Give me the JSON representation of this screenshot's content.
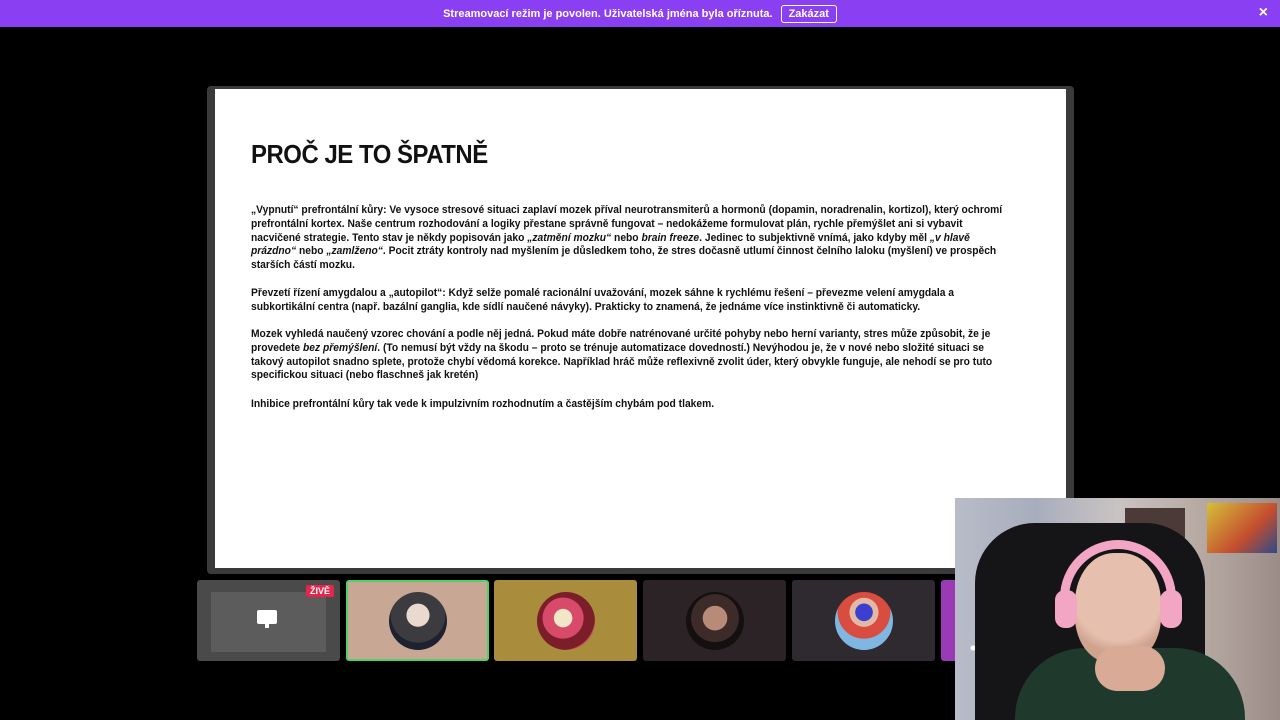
{
  "banner": {
    "message": "Streamovací režim je povolen. Uživatelská jména byla oříznuta.",
    "disable_label": "Zakázat",
    "close_icon": "×",
    "color": "#8a3ff2"
  },
  "slide": {
    "title": "PROČ JE TO ŠPATNĚ",
    "p1": "„Vypnutí“ prefrontální kůry: Ve vysoce stresové situaci zaplaví mozek příval neurotransmiterů a hormonů (dopamin, noradrenalin, kortizol), který ochromí prefrontální kortex. Naše centrum rozhodování a logiky přestane správně fungovat – nedokážeme formulovat plán, rychle přemýšlet ani si vybavit nacvičené strategie. Tento stav je někdy popisován jako",
    "p1_em1": "„zatmění mozku“",
    "p1_mid1": "nebo",
    "p1_em2": "brain freeze",
    "p1_mid2": ". Jedinec to subjektivně vnímá, jako kdyby měl",
    "p1_em3": "„v hlavě prázdno“",
    "p1_mid3": "nebo",
    "p1_em4": "„zamlženo“",
    "p1_end": ". Pocit ztráty kontroly nad myšlením je důsledkem toho, že stres dočasně utlumí činnost čelního laloku (myšlení) ve prospěch starších částí mozku.",
    "p2": "Převzetí řízení amygdalou a „autopilot“: Když selže pomalé racionální uvažování, mozek sáhne k rychlému řešení – převezme velení amygdala a subkortikální centra (např. bazální ganglia, kde sídlí naučené návyky). Prakticky to znamená, že jednáme více instinktivně či automaticky.",
    "p3_start": "Mozek vyhledá naučený vzorec chování a podle něj jedná. Pokud máte dobře natrénované určité pohyby nebo herní varianty, stres může způsobit, že je provedete",
    "p3_em": "bez přemýšlení",
    "p3_end": ". (To nemusí být vždy na škodu – proto se trénuje automatizace dovedností.) Nevýhodou je, že v nové nebo složité situaci se takový autopilot snadno splete, protože chybí vědomá korekce. Například hráč může reflexivně zvolit úder, který obvykle funguje, ale nehodí se pro tuto specifickou situaci (nebo flaschneš jak kretén)",
    "p4": "Inhibice prefrontální kůry tak vede k impulzivním rozhodnutím a častějším chybám pod tlakem."
  },
  "participants": {
    "live_badge": "ŽIVĚ",
    "screen_share_icon": "monitor-icon",
    "active_border_color": "#4ed36a"
  }
}
